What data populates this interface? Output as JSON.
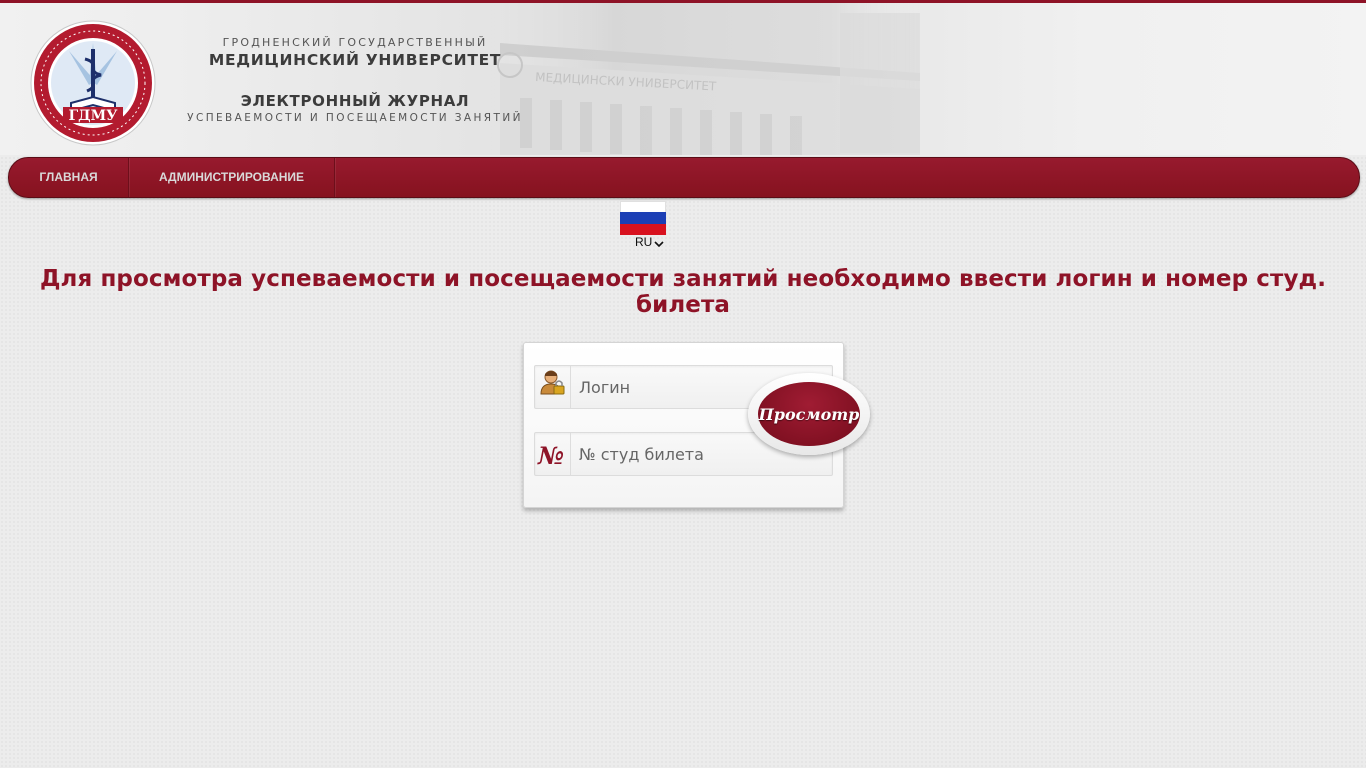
{
  "header": {
    "line1": "ГРОДНЕНСКИЙ ГОСУДАРСТВЕННЫЙ",
    "line2": "МЕДИЦИНСКИЙ УНИВЕРСИТЕТ",
    "line3": "ЭЛЕКТРОННЫЙ ЖУРНАЛ",
    "line4": "УСПЕВАЕМОСТИ И ПОСЕЩАЕМОСТИ ЗАНЯТИЙ",
    "logo_text": "ГДМУ",
    "building_sign": "МЕДИЦИНСКИ УНИВЕРСИТЕТ"
  },
  "nav": {
    "items": [
      {
        "label": "ГЛАВНАЯ"
      },
      {
        "label": "АДМИНИСТРИРОВАНИЕ"
      }
    ]
  },
  "language": {
    "selected": "RU",
    "flag_colors": [
      "#ffffff",
      "#1c3fb5",
      "#d8121f"
    ]
  },
  "notice": "Для просмотра успеваемости и посещаемости занятий необходимо ввести логин и номер студ. билета",
  "form": {
    "login_placeholder": "Логин",
    "ticket_placeholder": "№ студ билета",
    "ticket_icon": "№",
    "submit_label": "Просмотр"
  },
  "colors": {
    "accent": "#8e1327",
    "background": "#ececec"
  }
}
